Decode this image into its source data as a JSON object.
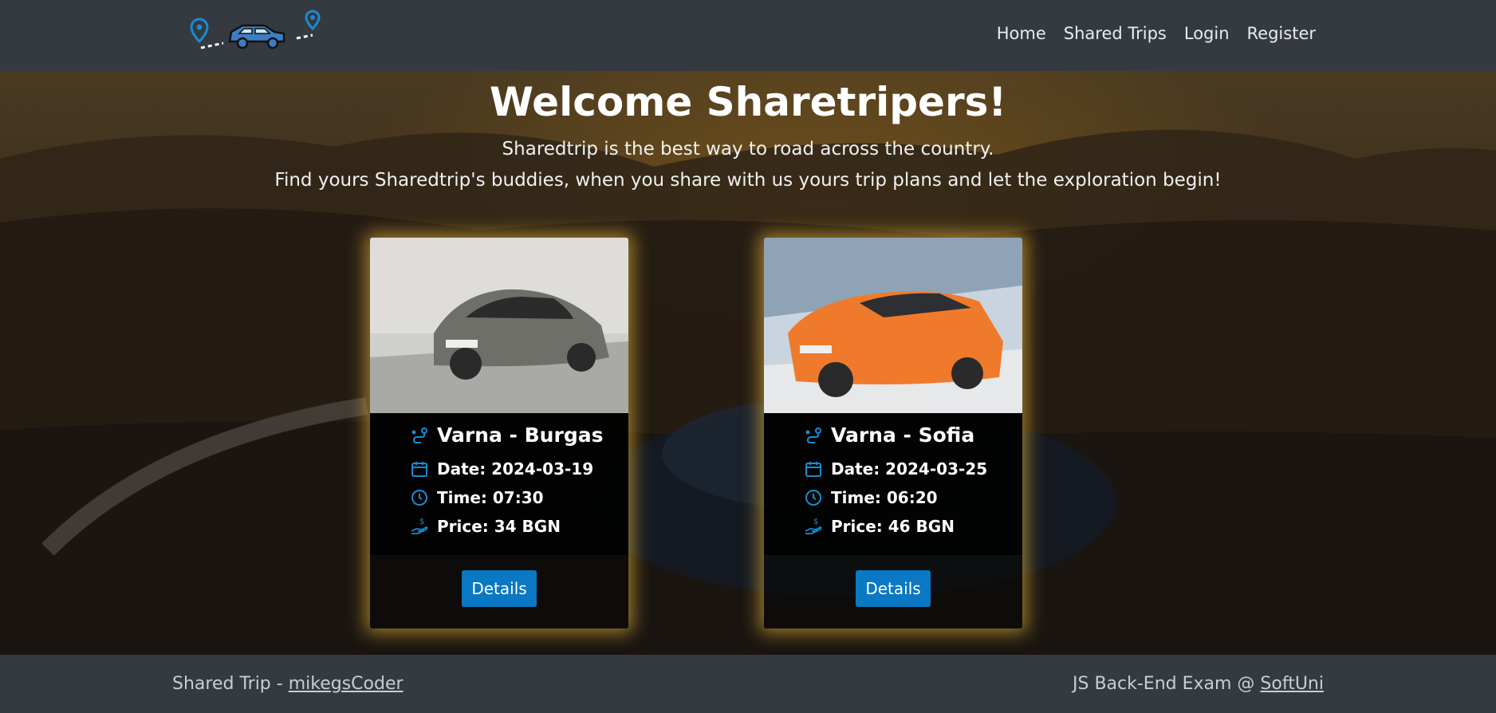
{
  "nav": {
    "links": [
      "Home",
      "Shared Trips",
      "Login",
      "Register"
    ]
  },
  "hero": {
    "title": "Welcome Sharetripers!",
    "line1": "Sharedtrip is the best way to road across the country.",
    "line2": "Find yours Sharedtrip's buddies, when you share with us yours trip plans and let the exploration begin!"
  },
  "trips": [
    {
      "route": "Varna - Burgas",
      "date": "Date: 2024-03-19",
      "time": "Time: 07:30",
      "price": "Price: 34 BGN",
      "details_label": "Details",
      "car_color": "#6f6f6a"
    },
    {
      "route": "Varna - Sofia",
      "date": "Date: 2024-03-25",
      "time": "Time: 06:20",
      "price": "Price: 46 BGN",
      "details_label": "Details",
      "car_color": "#f07a2c"
    }
  ],
  "footer": {
    "left_prefix": "Shared Trip - ",
    "left_link": "mikegsCoder",
    "right_prefix": "JS Back-End Exam @ ",
    "right_link": "SoftUni"
  },
  "colors": {
    "accent": "#0a78c2",
    "card_glow": "#ffc83c",
    "navbar": "#343a40"
  },
  "icons": [
    "map-pin-icon",
    "car-icon",
    "route-icon",
    "calendar-icon",
    "clock-icon",
    "price-hand-icon"
  ]
}
